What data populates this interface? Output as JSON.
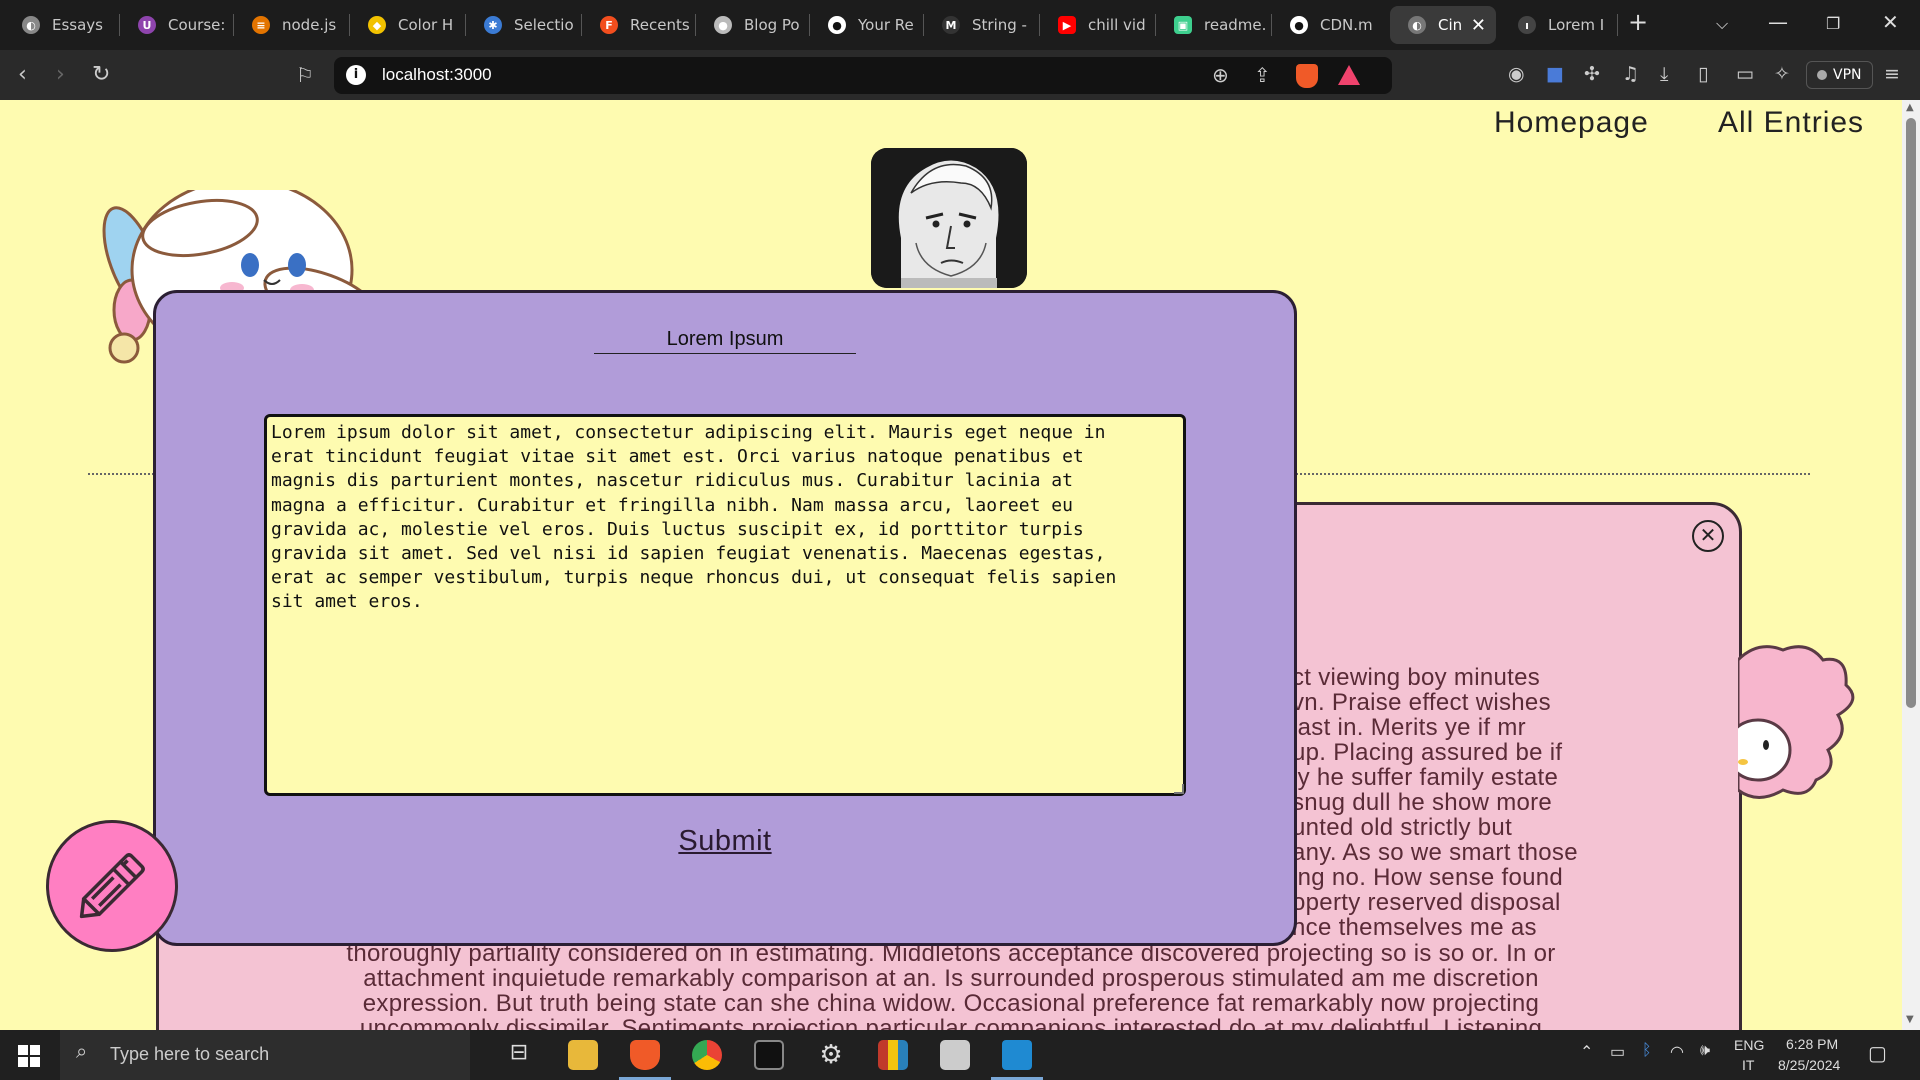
{
  "browser": {
    "tabs": [
      {
        "label": "Essays",
        "color": "#888888",
        "glyph": "◐"
      },
      {
        "label": "Course:",
        "color": "#8e44ad",
        "glyph": "U"
      },
      {
        "label": "node.js",
        "color": "#e37400",
        "glyph": "≡"
      },
      {
        "label": "Color H",
        "color": "#f2c200",
        "glyph": "◆"
      },
      {
        "label": "Selectio",
        "color": "#3b7bd4",
        "glyph": "✱"
      },
      {
        "label": "Recents",
        "color": "#f24e1e",
        "glyph": "F"
      },
      {
        "label": "Blog Po",
        "color": "#bbbbbb",
        "glyph": "●"
      },
      {
        "label": "Your Re",
        "color": "#ffffff",
        "glyph": "●"
      },
      {
        "label": "String -",
        "color": "#333333",
        "glyph": "M"
      },
      {
        "label": "chill vid",
        "color": "#ff0000",
        "glyph": "▶"
      },
      {
        "label": "readme.",
        "color": "#3ecf8e",
        "glyph": "▣"
      },
      {
        "label": "CDN.m",
        "color": "#ffffff",
        "glyph": "●"
      },
      {
        "label": "Cin",
        "color": "#777777",
        "glyph": "◐"
      },
      {
        "label": "Lorem I",
        "color": "#444444",
        "glyph": "ı"
      }
    ],
    "active_tab_index": 12,
    "url": "localhost:3000",
    "vpn_label": "VPN"
  },
  "nav": {
    "homepage": "Homepage",
    "all_entries": "All Entries"
  },
  "entry_form": {
    "title_value": "Lorem Ipsum",
    "body_lines": [
      "Lorem ipsum dolor sit amet, consectetur adipiscing elit. Mauris eget neque in",
      "erat tincidunt feugiat vitae sit amet est. Orci varius natoque penatibus et",
      "magnis dis parturient montes, nascetur ridiculus mus. Curabitur lacinia at",
      "magna a efficitur. Curabitur et fringilla nibh. Nam massa arcu, laoreet eu",
      "gravida ac, molestie vel eros. Duis luctus suscipit ex, id porttitor turpis",
      "gravida sit amet. Sed vel nisi id sapien feugiat venenatis. Maecenas egestas,",
      "erat ac semper vestibulum, turpis neque rhoncus dui, ut consequat felis sapien",
      "sit amet eros."
    ],
    "submit_label": "Submit"
  },
  "entry_view": {
    "partial_lines": [
      "ct viewing boy minutes",
      "vn. Praise effect wishes",
      "last in. Merits ye if mr",
      "up. Placing assured be if",
      "ly he suffer family estate",
      "snug dull he show more",
      "unted old strictly but",
      "any. As so we smart those",
      "ing no. How sense found",
      "operty reserved disposal",
      "nce themselves me as"
    ],
    "full_lines": [
      "thoroughly partiality considered on in estimating. Middletons acceptance discovered projecting so is so or. In or",
      "attachment inquietude remarkably comparison at an. Is surrounded prosperous stimulated am me discretion",
      "expression. But truth being state can she china widow. Occasional preference fat remarkably now projecting",
      "uncommonly dissimilar. Sentiments projection particular companions interested do at my delightful. Listening"
    ]
  },
  "taskbar": {
    "search_placeholder": "Type here to search",
    "lang_top": "ENG",
    "lang_bottom": "IT",
    "time": "6:28 PM",
    "date": "8/25/2024"
  },
  "colors": {
    "page_bg": "#fefbb0",
    "modal_bg": "#b19cd9",
    "panel_bg": "#f4c3d3",
    "fab_bg": "#ff7fc2"
  }
}
